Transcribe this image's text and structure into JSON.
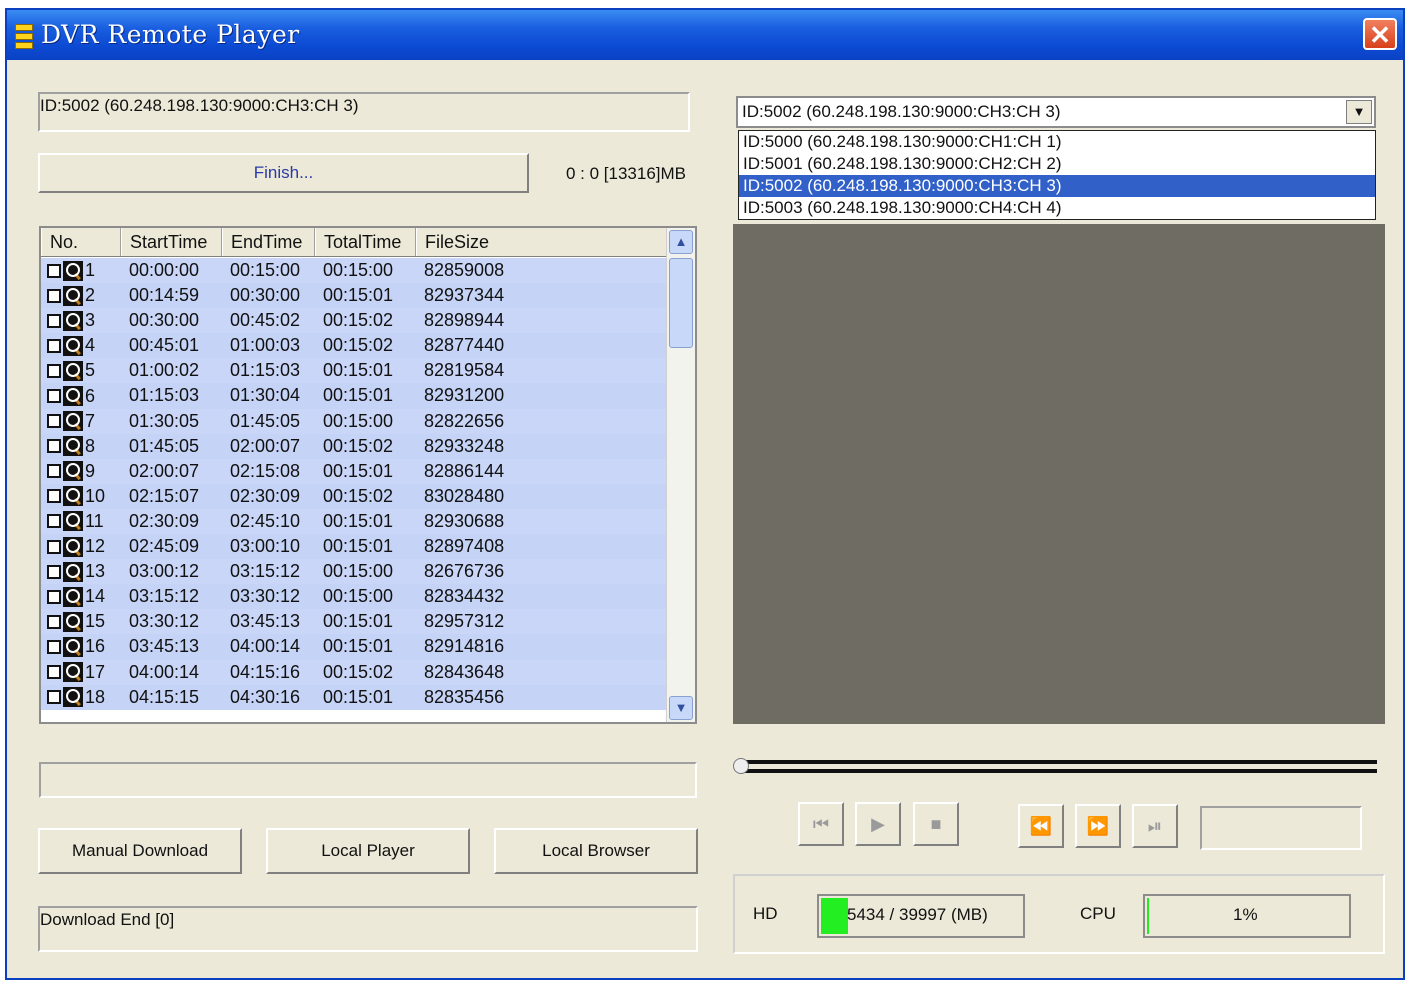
{
  "window": {
    "title": "DVR Remote Player",
    "close_label": "✕"
  },
  "left": {
    "device_field": "ID:5002 (60.248.198.130:9000:CH3:CH 3)",
    "status_button": "Finish...",
    "size_info": "0 : 0 [13316]MB",
    "columns": [
      "No.",
      "StartTime",
      "EndTime",
      "TotalTime",
      "FileSize"
    ],
    "rows": [
      {
        "no": "1",
        "start": "00:00:00",
        "end": "00:15:00",
        "total": "00:15:00",
        "size": "82859008"
      },
      {
        "no": "2",
        "start": "00:14:59",
        "end": "00:30:00",
        "total": "00:15:01",
        "size": "82937344"
      },
      {
        "no": "3",
        "start": "00:30:00",
        "end": "00:45:02",
        "total": "00:15:02",
        "size": "82898944"
      },
      {
        "no": "4",
        "start": "00:45:01",
        "end": "01:00:03",
        "total": "00:15:02",
        "size": "82877440"
      },
      {
        "no": "5",
        "start": "01:00:02",
        "end": "01:15:03",
        "total": "00:15:01",
        "size": "82819584"
      },
      {
        "no": "6",
        "start": "01:15:03",
        "end": "01:30:04",
        "total": "00:15:01",
        "size": "82931200"
      },
      {
        "no": "7",
        "start": "01:30:05",
        "end": "01:45:05",
        "total": "00:15:00",
        "size": "82822656"
      },
      {
        "no": "8",
        "start": "01:45:05",
        "end": "02:00:07",
        "total": "00:15:02",
        "size": "82933248"
      },
      {
        "no": "9",
        "start": "02:00:07",
        "end": "02:15:08",
        "total": "00:15:01",
        "size": "82886144"
      },
      {
        "no": "10",
        "start": "02:15:07",
        "end": "02:30:09",
        "total": "00:15:02",
        "size": "83028480"
      },
      {
        "no": "11",
        "start": "02:30:09",
        "end": "02:45:10",
        "total": "00:15:01",
        "size": "82930688"
      },
      {
        "no": "12",
        "start": "02:45:09",
        "end": "03:00:10",
        "total": "00:15:01",
        "size": "82897408"
      },
      {
        "no": "13",
        "start": "03:00:12",
        "end": "03:15:12",
        "total": "00:15:00",
        "size": "82676736"
      },
      {
        "no": "14",
        "start": "03:15:12",
        "end": "03:30:12",
        "total": "00:15:00",
        "size": "82834432"
      },
      {
        "no": "15",
        "start": "03:30:12",
        "end": "03:45:13",
        "total": "00:15:01",
        "size": "82957312"
      },
      {
        "no": "16",
        "start": "03:45:13",
        "end": "04:00:14",
        "total": "00:15:01",
        "size": "82914816"
      },
      {
        "no": "17",
        "start": "04:00:14",
        "end": "04:15:16",
        "total": "00:15:02",
        "size": "82843648"
      },
      {
        "no": "18",
        "start": "04:15:15",
        "end": "04:30:16",
        "total": "00:15:01",
        "size": "82835456"
      }
    ],
    "buttons": {
      "manual_download": "Manual Download",
      "local_player": "Local Player",
      "local_browser": "Local Browser"
    },
    "status_log": "Download End [0]"
  },
  "right": {
    "channel_selected": "ID:5002 (60.248.198.130:9000:CH3:CH 3)",
    "channel_options": [
      "ID:5000 (60.248.198.130:9000:CH1:CH 1)",
      "ID:5001 (60.248.198.130:9000:CH2:CH 2)",
      "ID:5002 (60.248.198.130:9000:CH3:CH 3)",
      "ID:5003 (60.248.198.130:9000:CH4:CH 4)"
    ],
    "highlighted_option_index": 2,
    "playback_icons": [
      "skip-back-icon",
      "play-icon",
      "stop-icon",
      "rewind-icon",
      "fast-forward-icon",
      "step-forward-icon"
    ],
    "hd_label": "HD",
    "hd_value": "5434 / 39997 (MB)",
    "hd_fill": 0.136,
    "cpu_label": "CPU",
    "cpu_value": "1%",
    "cpu_fill": 0.01
  },
  "colors": {
    "title_bar": "#0d4bd4",
    "row_bg": "#c5d3f6",
    "video_bg": "#6f6d63",
    "selection": "#3160c8",
    "hd_meter": "#22ee22"
  }
}
